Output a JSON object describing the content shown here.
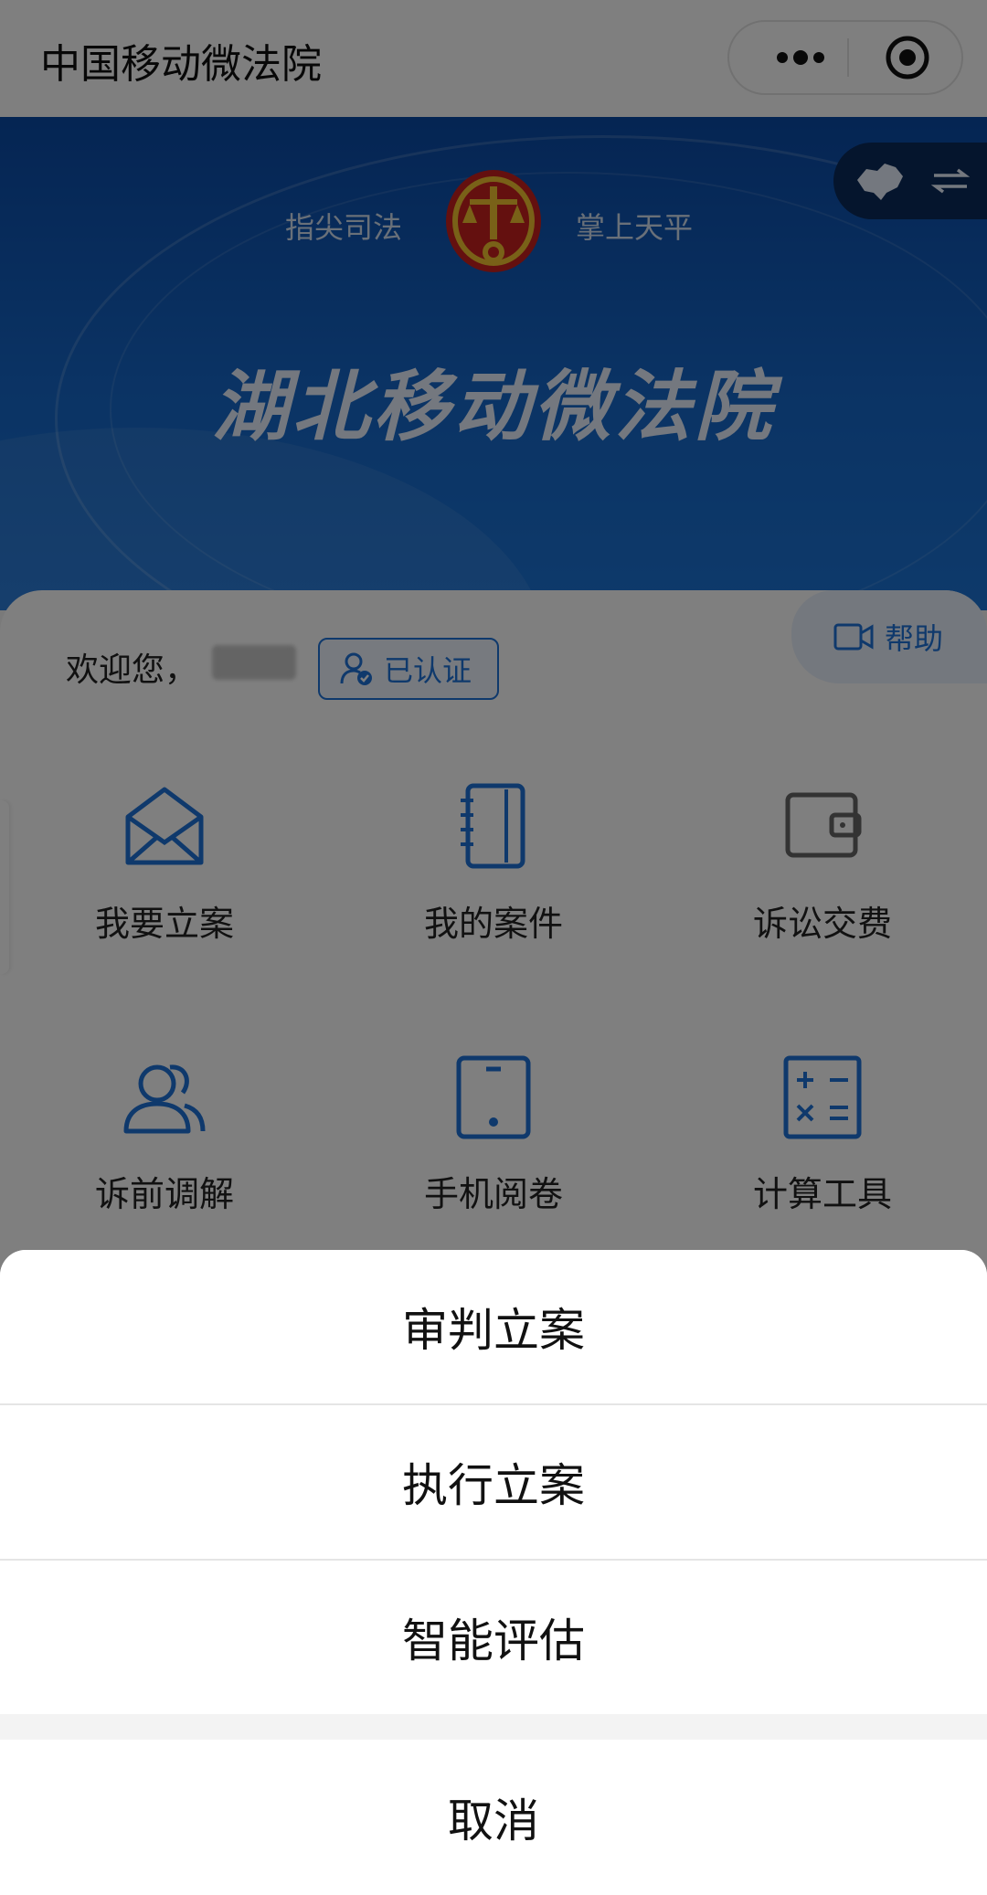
{
  "navbar": {
    "title": "中国移动微法院"
  },
  "banner": {
    "slogan_left": "指尖司法",
    "slogan_right": "掌上天平",
    "title": "湖北移动微法院"
  },
  "user": {
    "welcome": "欢迎您，",
    "verified_label": "已认证"
  },
  "help_label": "帮助",
  "grid": [
    {
      "label": "我要立案",
      "icon": "envelope-icon"
    },
    {
      "label": "我的案件",
      "icon": "notebook-icon"
    },
    {
      "label": "诉讼交费",
      "icon": "wallet-icon"
    },
    {
      "label": "诉前调解",
      "icon": "people-icon"
    },
    {
      "label": "手机阅卷",
      "icon": "tablet-icon"
    },
    {
      "label": "计算工具",
      "icon": "calculator-icon"
    }
  ],
  "action_sheet": {
    "items": [
      "审判立案",
      "执行立案",
      "智能评估"
    ],
    "cancel": "取消"
  },
  "colors": {
    "accent": "#1e73d9",
    "banner": "#0a4aa6",
    "mask": "rgba(0,0,0,0.5)"
  }
}
